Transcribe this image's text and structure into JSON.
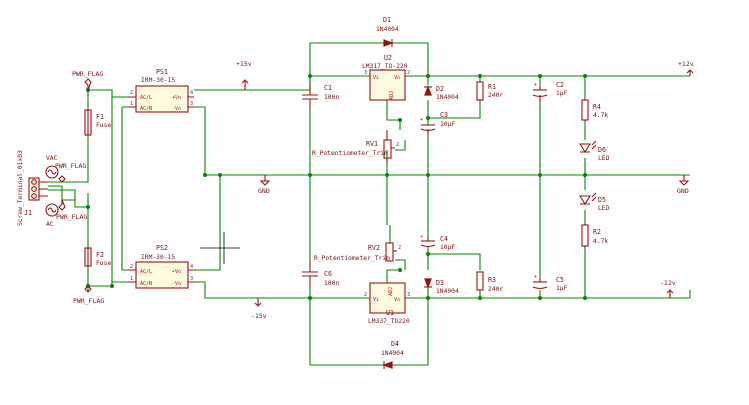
{
  "power": {
    "p15v": "+15v",
    "n15v": "-15v",
    "p12v": "+12v",
    "n12v": "-12v",
    "gnd": "GND"
  },
  "flags": {
    "pwr_flag": "PWR_FLAG"
  },
  "components": {
    "j1": {
      "ref": "J1",
      "value": "Screw_Terminal_01x03"
    },
    "vac1": {
      "ref": "VAC",
      "label": "AC"
    },
    "vac2": {
      "ref": "AC",
      "label": ""
    },
    "f1": {
      "ref": "F1",
      "value": "Fuse"
    },
    "f2": {
      "ref": "F2",
      "value": "Fuse"
    },
    "ps1": {
      "ref": "PS1",
      "value": "IRM-30-15",
      "pin_acl": "AC/L",
      "pin_acn": "AC/N",
      "pin_vp": "+Vo",
      "pin_vn": "-Vo"
    },
    "ps2": {
      "ref": "PS2",
      "value": "IRM-30-15",
      "pin_acl": "AC/L",
      "pin_acn": "AC/N",
      "pin_vp": "+Vo",
      "pin_vn": "-Vo"
    },
    "c1": {
      "ref": "C1",
      "value": "100n"
    },
    "c6": {
      "ref": "C6",
      "value": "100n"
    },
    "u2": {
      "ref": "U2",
      "value": "LM317_TO-220",
      "vi": "Vi",
      "vo": "Vo",
      "adj": "ADJ"
    },
    "u1": {
      "ref": "U1",
      "value": "LM337_TO220",
      "vi": "Vi",
      "vo": "Vo",
      "adj": "ADJ"
    },
    "d1": {
      "ref": "D1",
      "value": "1N4004"
    },
    "d2": {
      "ref": "D2",
      "value": "1N4004"
    },
    "d3": {
      "ref": "D3",
      "value": "1N4004"
    },
    "d4": {
      "ref": "D4",
      "value": "1N4004"
    },
    "r1": {
      "ref": "R1",
      "value": "240r"
    },
    "r3": {
      "ref": "R3",
      "value": "240r"
    },
    "c3": {
      "ref": "C3",
      "value": "10µF"
    },
    "c4": {
      "ref": "C4",
      "value": "10µF"
    },
    "rv1": {
      "ref": "RV1",
      "value": "R_Potentiometer_Trim"
    },
    "rv2": {
      "ref": "RV2",
      "value": "R_Potentiometer_Trim"
    },
    "c2": {
      "ref": "C2",
      "value": "1µF"
    },
    "c5": {
      "ref": "C5",
      "value": "1µF"
    },
    "r4": {
      "ref": "R4",
      "value": "4.7k"
    },
    "r2": {
      "ref": "R2",
      "value": "4.7k"
    },
    "d6": {
      "ref": "D6",
      "value": "LED"
    },
    "d5": {
      "ref": "D5",
      "value": "LED"
    }
  },
  "colors": {
    "wire": "#008800",
    "component": "#9b1111",
    "text": "#7a1212",
    "pin_number": "#3a3a8a",
    "background": "#ffffff"
  }
}
